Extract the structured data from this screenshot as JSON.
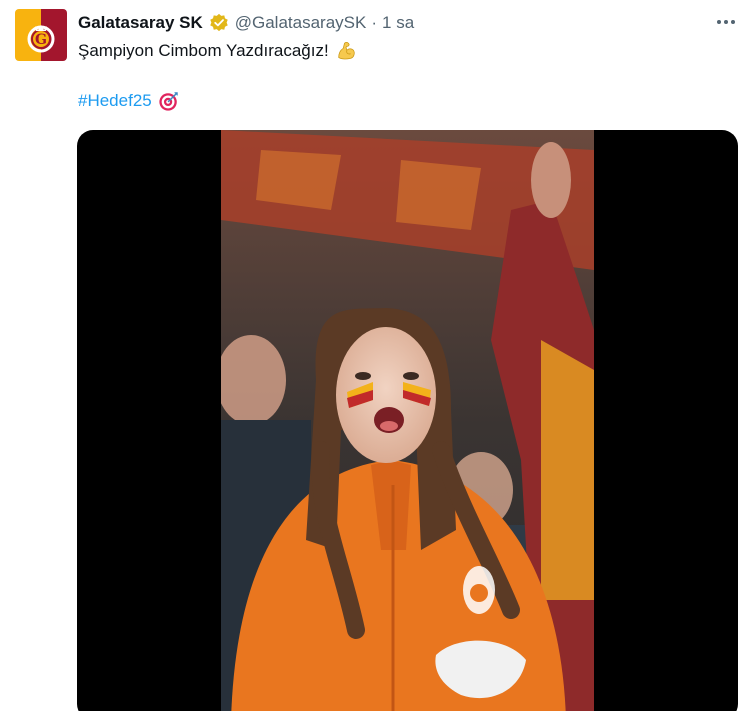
{
  "account": {
    "display_name": "Galatasaray SK",
    "handle": "@GalatasaraySK",
    "separator": "·",
    "time": "1 sa"
  },
  "tweet": {
    "text": "Şampiyon Cimbom Yazdıracağız!",
    "hashtag": "#Hedef25"
  },
  "icons": {
    "avatar": "galatasaray-logo",
    "verified": "verified-badge-icon",
    "more": "more-options-icon",
    "emoji_1": "flexed-biceps-emoji",
    "emoji_2": "direct-hit-target-emoji"
  },
  "colors": {
    "brand_yellow": "#f8b30f",
    "brand_red": "#a3162d",
    "link": "#1d9bf0",
    "verified_gold": "#e2b719",
    "muted": "#536471"
  }
}
